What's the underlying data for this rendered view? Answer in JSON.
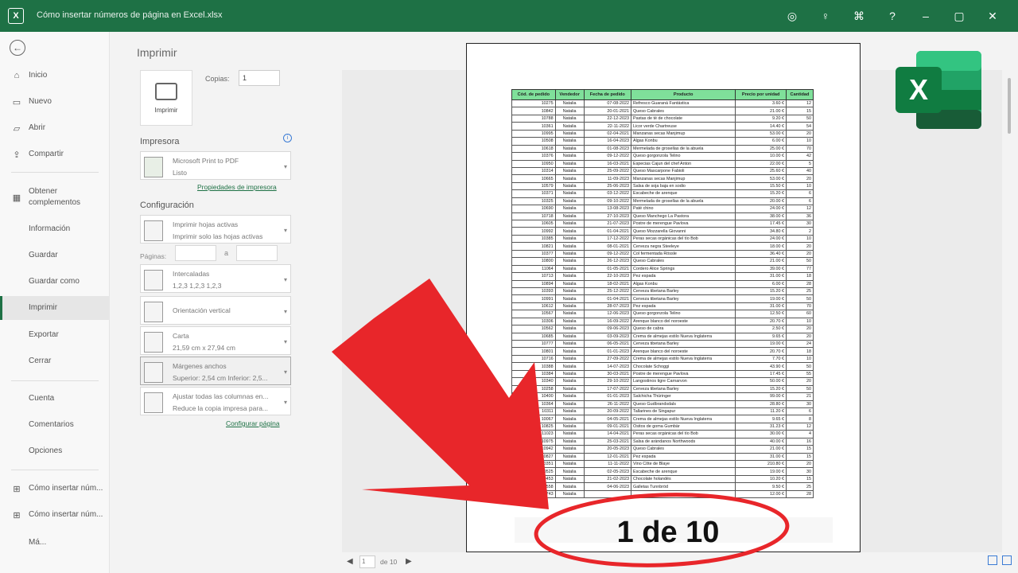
{
  "window": {
    "app_icon": "excel-icon",
    "title": "Cómo insertar números de página en Excel.xlsx"
  },
  "sidebar": {
    "back_icon": "back-arrow-icon",
    "items": [
      {
        "label": "Inicio",
        "icon": "home-icon"
      },
      {
        "label": "Nuevo",
        "icon": "new-document-icon"
      },
      {
        "label": "Abrir",
        "icon": "folder-icon"
      },
      {
        "label": "Compartir",
        "icon": "share-icon"
      },
      {
        "label": "Obtener complementos",
        "icon": "grid-icon"
      },
      {
        "label": "Información"
      },
      {
        "label": "Guardar"
      },
      {
        "label": "Guardar como"
      },
      {
        "label": "Imprimir",
        "active": true
      },
      {
        "label": "Exportar"
      },
      {
        "label": "Cerrar"
      },
      {
        "label": "Cuenta"
      },
      {
        "label": "Comentarios"
      },
      {
        "label": "Opciones"
      },
      {
        "label": "Cómo insertar núm..."
      },
      {
        "label": "Cómo insertar núm..."
      },
      {
        "label": "Má..."
      }
    ]
  },
  "print": {
    "title": "Imprimir",
    "print_button": "Imprimir",
    "copies_label": "Copias:",
    "copies_value": "1",
    "printer_section": "Impresora",
    "printer_name": "Microsoft Print to PDF",
    "printer_status": "Listo",
    "printer_properties_link": "Propiedades de impresora",
    "config_section": "Configuración",
    "config": [
      {
        "line1": "Imprimir hojas activas",
        "line2": "Imprimir solo las hojas activas"
      },
      {
        "line1": "Intercaladas",
        "line2": "1,2,3    1,2,3    1,2,3"
      },
      {
        "line1": "Orientación vertical",
        "line2": ""
      },
      {
        "line1": "Carta",
        "line2": "21,59 cm x 27,94 cm"
      },
      {
        "line1": "Márgenes anchos",
        "line2": "Superior: 2,54 cm Inferior: 2,5..."
      },
      {
        "line1": "Ajustar todas las columnas en...",
        "line2": "Reduce la copia impresa para..."
      }
    ],
    "pages_label": "Páginas:",
    "pages_to": "a",
    "page_setup_link": "Configurar página"
  },
  "preview": {
    "headers": [
      "Cód. de pedido",
      "Vendedor",
      "Fecha de pedido",
      "Producto",
      "Precio por unidad",
      "Cantidad"
    ],
    "rows": [
      [
        "10275",
        "Natalia",
        "07-08-2022",
        "Refresco Guaraná Fantástica",
        "3.60 €",
        "12"
      ],
      [
        "10842",
        "Natalia",
        "20-01-2021",
        "Queso Cabrales",
        "21.00 €",
        "15"
      ],
      [
        "10788",
        "Natalia",
        "22-12-2023",
        "Pastas de té de chocolate",
        "9.20 €",
        "50"
      ],
      [
        "10361",
        "Natalia",
        "22-11-2022",
        "Licor verde Chartreuse",
        "14.40 €",
        "54"
      ],
      [
        "10995",
        "Natalia",
        "02-04-2021",
        "Manzanas secas Manjimup",
        "53.00 €",
        "20"
      ],
      [
        "10508",
        "Natalia",
        "16-04-2023",
        "Algas Konbu",
        "6.00 €",
        "10"
      ],
      [
        "10618",
        "Natalia",
        "01-08-2023",
        "Mermelada de grosellas de la abuela",
        "25.00 €",
        "70"
      ],
      [
        "10376",
        "Natalia",
        "09-12-2022",
        "Queso gorgonzola Telino",
        "10.00 €",
        "42"
      ],
      [
        "10950",
        "Natalia",
        "16-03-2021",
        "Especias Cajun del chef Anton",
        "22.00 €",
        "5"
      ],
      [
        "10314",
        "Natalia",
        "25-09-2022",
        "Queso Mascarpone Fabioli",
        "25.60 €",
        "40"
      ],
      [
        "10665",
        "Natalia",
        "11-09-2023",
        "Manzanas secas Manjimup",
        "53.00 €",
        "20"
      ],
      [
        "10579",
        "Natalia",
        "25-06-2023",
        "Salsa de soja baja en sodio",
        "15.50 €",
        "10"
      ],
      [
        "10371",
        "Natalia",
        "03-12-2022",
        "Escabeche de arenque",
        "15.20 €",
        "6"
      ],
      [
        "10325",
        "Natalia",
        "09-10-2022",
        "Mermelada de grosellas de la abuela",
        "20.00 €",
        "6"
      ],
      [
        "10690",
        "Natalia",
        "13-08-2023",
        "Paté chino",
        "24.00 €",
        "12"
      ],
      [
        "10718",
        "Natalia",
        "27-10-2023",
        "Queso Manchego La Pastora",
        "38.00 €",
        "36"
      ],
      [
        "10605",
        "Natalia",
        "21-07-2023",
        "Postre de merengue Pavlova",
        "17.45 €",
        "30"
      ],
      [
        "10992",
        "Natalia",
        "01-04-2021",
        "Queso Mozzarella Giovanni",
        "34.80 €",
        "2"
      ],
      [
        "10385",
        "Natalia",
        "17-12-2022",
        "Peras secas orgánicas del tío Bob",
        "24.00 €",
        "10"
      ],
      [
        "10821",
        "Natalia",
        "08-01-2021",
        "Cerveza negra Steeleye",
        "18.00 €",
        "20"
      ],
      [
        "10377",
        "Natalia",
        "09-12-2022",
        "Col fermentada Rössle",
        "36.40 €",
        "20"
      ],
      [
        "10800",
        "Natalia",
        "26-12-2023",
        "Queso Cabrales",
        "21.00 €",
        "50"
      ],
      [
        "11064",
        "Natalia",
        "01-05-2021",
        "Cordero Alice Springs",
        "39.00 €",
        "77"
      ],
      [
        "10713",
        "Natalia",
        "22-10-2023",
        "Pez espada",
        "31.00 €",
        "18"
      ],
      [
        "10894",
        "Natalia",
        "18-02-2021",
        "Algas Konbu",
        "6.00 €",
        "28"
      ],
      [
        "10393",
        "Natalia",
        "25-12-2022",
        "Cerveza tibetana Barley",
        "15.20 €",
        "25"
      ],
      [
        "10991",
        "Natalia",
        "01-04-2021",
        "Cerveza tibetana Barley",
        "19.00 €",
        "50"
      ],
      [
        "10612",
        "Natalia",
        "28-07-2023",
        "Pez espada",
        "31.00 €",
        "70"
      ],
      [
        "10567",
        "Natalia",
        "12-06-2023",
        "Queso gorgonzola Telino",
        "12.50 €",
        "60"
      ],
      [
        "10306",
        "Natalia",
        "16-09-2022",
        "Arenque blanco del noroeste",
        "20.70 €",
        "10"
      ],
      [
        "10562",
        "Natalia",
        "09-06-2023",
        "Queso de cabra",
        "2.50 €",
        "20"
      ],
      [
        "10685",
        "Natalia",
        "03-09-2023",
        "Crema de almejas estilo Nueva Inglaterra",
        "9.65 €",
        "20"
      ],
      [
        "10777",
        "Natalia",
        "06-05-2021",
        "Cerveza tibetana Barley",
        "19.00 €",
        "24"
      ],
      [
        "10801",
        "Natalia",
        "01-01-2023",
        "Arenque blanco del noroeste",
        "20.70 €",
        "18"
      ],
      [
        "10716",
        "Natalia",
        "27-09-2022",
        "Crema de almejas estilo Nueva Inglaterra",
        "7.70 €",
        "10"
      ],
      [
        "10388",
        "Natalia",
        "14-07-2023",
        "Chocolate Schoggi",
        "43.90 €",
        "50"
      ],
      [
        "10384",
        "Natalia",
        "30-03-2021",
        "Postre de merengue Pavlova",
        "17.45 €",
        "55"
      ],
      [
        "10340",
        "Natalia",
        "29-10-2022",
        "Langostinos tigre Carnarvon",
        "50.00 €",
        "20"
      ],
      [
        "10258",
        "Natalia",
        "17-07-2022",
        "Cerveza tibetana Barley",
        "15.20 €",
        "50"
      ],
      [
        "10400",
        "Natalia",
        "01-01-2023",
        "Salchicha Thüringer",
        "99.00 €",
        "21"
      ],
      [
        "10364",
        "Natalia",
        "26-11-2022",
        "Queso Gudbrandsdals",
        "28.80 €",
        "30"
      ],
      [
        "10311",
        "Natalia",
        "20-09-2022",
        "Tallarines de Singapur",
        "11.20 €",
        "6"
      ],
      [
        "10067",
        "Natalia",
        "04-05-2021",
        "Crema de almejas estilo Nueva Inglaterra",
        "9.65 €",
        "8"
      ],
      [
        "10825",
        "Natalia",
        "09-01-2021",
        "Ositos de goma Gumbär",
        "31.23 €",
        "12"
      ],
      [
        "11023",
        "Natalia",
        "14-04-2021",
        "Peras secas orgánicas del tío Bob",
        "30.00 €",
        "4"
      ],
      [
        "10975",
        "Natalia",
        "25-03-2021",
        "Salsa de arándanos Northwoods",
        "40.00 €",
        "16"
      ],
      [
        "10942",
        "Natalia",
        "20-05-2023",
        "Queso Cabrales",
        "21.00 €",
        "15"
      ],
      [
        "10827",
        "Natalia",
        "12-01-2021",
        "Pez espada",
        "31.00 €",
        "15"
      ],
      [
        "10351",
        "Natalia",
        "11-11-2022",
        "Vino Côte de Blaye",
        "210.80 €",
        "20"
      ],
      [
        "10525",
        "Natalia",
        "02-05-2023",
        "Escabeche de arenque",
        "19.00 €",
        "30"
      ],
      [
        "10453",
        "Natalia",
        "21-02-2023",
        "Chocolate holandés",
        "10.20 €",
        "15"
      ],
      [
        "10558",
        "Natalia",
        "04-06-2023",
        "Galletas Tunnbröd",
        "9.50 €",
        "25"
      ],
      [
        "10743",
        "Natalia",
        "",
        "",
        "12.00 €",
        "28"
      ]
    ],
    "page_indicator": "1 de 10"
  },
  "nav": {
    "current_page": "1",
    "of_total": "de 10"
  },
  "colors": {
    "title_bar": "#1e7145",
    "header_fill": "#7fe09a",
    "arrow": "#e8262a",
    "circle": "#e8262a"
  }
}
